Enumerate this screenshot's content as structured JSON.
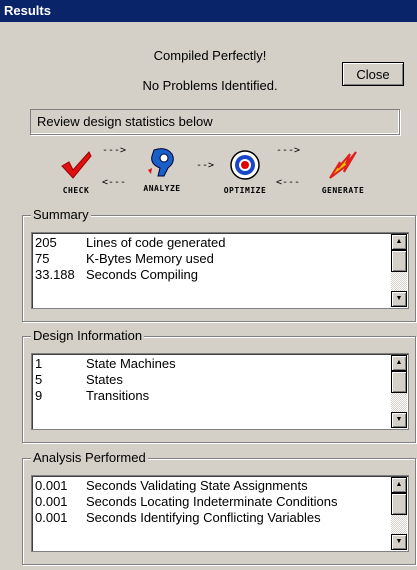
{
  "window": {
    "title": "Results"
  },
  "status": {
    "line1": "Compiled Perfectly!",
    "line2": "No Problems Identified."
  },
  "close_label": "Close",
  "review_text": "Review design statistics below",
  "workflow": {
    "steps": [
      {
        "label": "CHECK",
        "icon": "checkmark-icon"
      },
      {
        "label": "ANALYZE",
        "icon": "analyze-icon"
      },
      {
        "label": "OPTIMIZE",
        "icon": "target-icon"
      },
      {
        "label": "GENERATE",
        "icon": "lightning-icon"
      }
    ],
    "arrow_fwd": "--->",
    "arrow_back": "<---",
    "arrow_short": "-->"
  },
  "summary": {
    "title": "Summary",
    "rows": [
      {
        "value": "205",
        "label": "Lines of code generated"
      },
      {
        "value": "75",
        "label": "K-Bytes Memory used"
      },
      {
        "value": "33.188",
        "label": "Seconds Compiling"
      }
    ]
  },
  "design": {
    "title": "Design Information",
    "rows": [
      {
        "value": "1",
        "label": "State Machines"
      },
      {
        "value": "5",
        "label": "States"
      },
      {
        "value": "9",
        "label": "Transitions"
      }
    ]
  },
  "analysis": {
    "title": "Analysis Performed",
    "rows": [
      {
        "value": "0.001",
        "label": "Seconds Validating State Assignments"
      },
      {
        "value": "0.001",
        "label": "Seconds Locating Indeterminate Conditions"
      },
      {
        "value": "0.001",
        "label": "Seconds Identifying Conflicting Variables"
      }
    ]
  },
  "colors": {
    "titlebar": "#0a246a",
    "window_bg": "#d4d0c8",
    "check_red": "#e01010",
    "analyze_blue": "#1860c8",
    "optimize_red": "#e00000",
    "generate_red": "#e02020",
    "generate_yellow": "#f0c000"
  }
}
